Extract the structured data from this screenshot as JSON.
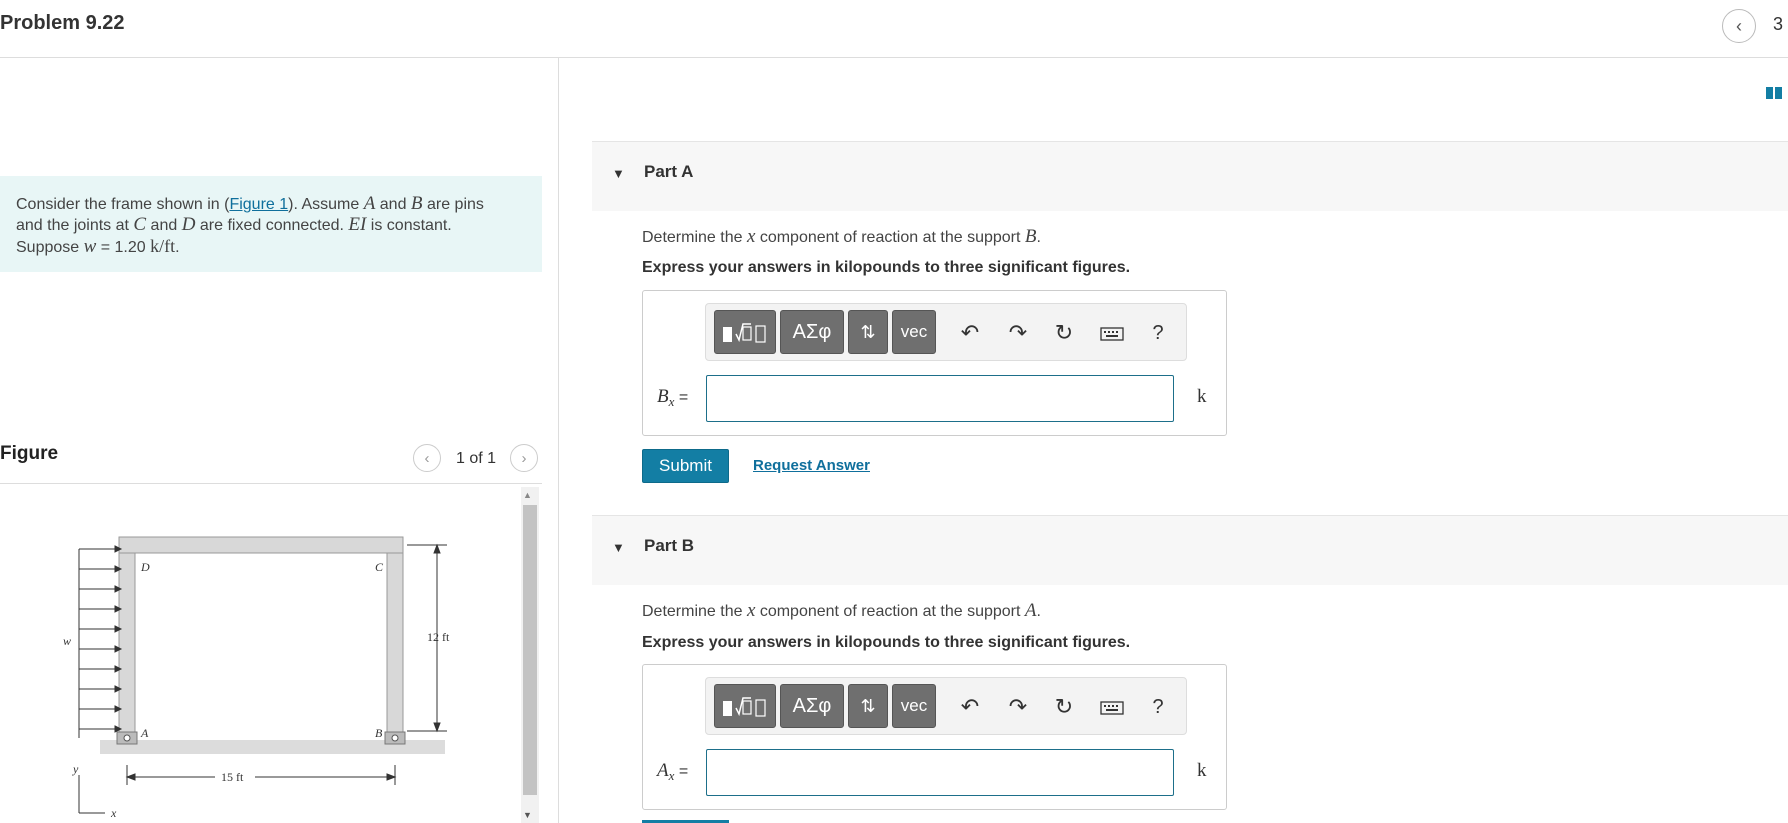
{
  "header": {
    "title": "Problem 9.22",
    "nav_number": "3"
  },
  "problem": {
    "t1": "Consider the frame shown in (",
    "figure_link": "Figure 1",
    "t2": "). Assume ",
    "varA": "A",
    "t3": " and ",
    "varB": "B",
    "t4": " are pins",
    "t5": "and the joints at ",
    "varC": "C",
    "t6": " and ",
    "varD": "D",
    "t7": " are fixed connected. ",
    "varEI": "EI",
    "t8": " is constant.",
    "t9": "Suppose ",
    "varw": "w",
    "t10": " = 1.20 ",
    "unit": "k/ft",
    "t11": "."
  },
  "figure": {
    "label": "Figure",
    "count": "1 of 1",
    "labels": {
      "w": "w",
      "D": "D",
      "C": "C",
      "A": "A",
      "B": "B",
      "height": "12 ft",
      "width": "15 ft",
      "y": "y",
      "x": "x"
    }
  },
  "parts": [
    {
      "name": "Part A",
      "q1": "Determine the ",
      "qx": "x",
      "q2": " component of reaction at the support ",
      "qs": "B",
      "q3": ".",
      "instruction": "Express your answers in kilopounds to three significant figures.",
      "var": "B",
      "var_sub": "x",
      "eq": " =",
      "unit": "k",
      "input_value": ""
    },
    {
      "name": "Part B",
      "q1": "Determine the ",
      "qx": "x",
      "q2": " component of reaction at the support ",
      "qs": "A",
      "q3": ".",
      "instruction": "Express your answers in kilopounds to three significant figures.",
      "var": "A",
      "var_sub": "x",
      "eq": " =",
      "unit": "k",
      "input_value": ""
    }
  ],
  "toolbar": {
    "greek_label": "ΑΣφ",
    "vec_label": "vec",
    "help_label": "?"
  },
  "actions": {
    "submit_label": "Submit",
    "request_label": "Request Answer"
  },
  "colors": {
    "accent": "#137ea4",
    "problem_bg": "#e8f6f6",
    "toolbar_button": "#6f6f6f"
  }
}
